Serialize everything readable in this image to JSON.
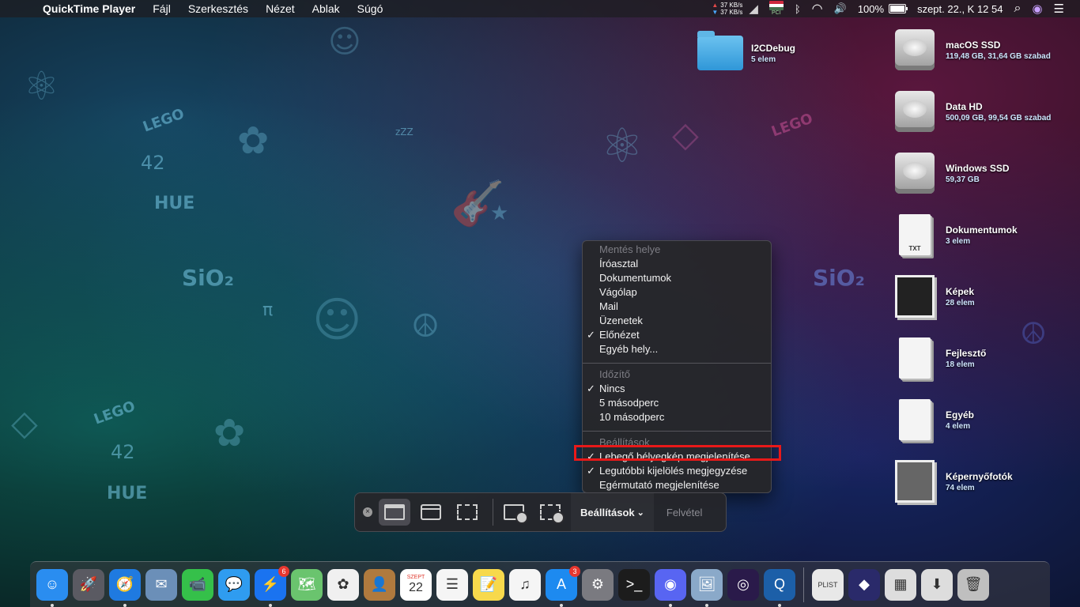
{
  "menubar": {
    "apple": "",
    "app_name": "QuickTime Player",
    "items": [
      "Fájl",
      "Szerkesztés",
      "Nézet",
      "Ablak",
      "Súgó"
    ],
    "net_up": "37 KB/s",
    "net_down": "37 KB/s",
    "pci_label": "PCI",
    "bluetooth": "ᛒ",
    "volume": "🔊",
    "wifi": "◠",
    "battery_percent": "100%",
    "battery_level": 1.0,
    "datetime": "szept. 22., K  12 54",
    "search": "⌕",
    "siri": "◉",
    "menu_list": "☰"
  },
  "desktop": [
    {
      "name": "I2CDebug",
      "sub": "5 elem",
      "kind": "folder"
    },
    {
      "name": "macOS SSD",
      "sub": "119,48 GB, 31,64 GB szabad",
      "kind": "hdd"
    },
    {
      "name": "Data HD",
      "sub": "500,09 GB, 99,54 GB szabad",
      "kind": "hdd"
    },
    {
      "name": "Windows SSD",
      "sub": "59,37 GB",
      "kind": "hdd"
    },
    {
      "name": "Dokumentumok",
      "sub": "3 elem",
      "kind": "doc",
      "icon_label": "TXT"
    },
    {
      "name": "Képek",
      "sub": "28 elem",
      "kind": "stack"
    },
    {
      "name": "Fejlesztő",
      "sub": "18 elem",
      "kind": "doc",
      "icon_label": ""
    },
    {
      "name": "Egyéb",
      "sub": "4 elem",
      "kind": "doc",
      "icon_label": ""
    },
    {
      "name": "Képernyőfotók",
      "sub": "74 elem",
      "kind": "stack"
    }
  ],
  "wallpaper_text": {
    "hue": "HUE",
    "sio2": "SiO₂",
    "lego": "LEGO",
    "n42": "42",
    "zzz": "zZZ",
    "pi": "π"
  },
  "popup": {
    "sections": [
      {
        "header": "Mentés helye",
        "items": [
          {
            "label": "Íróasztal",
            "checked": false
          },
          {
            "label": "Dokumentumok",
            "checked": false
          },
          {
            "label": "Vágólap",
            "checked": false
          },
          {
            "label": "Mail",
            "checked": false
          },
          {
            "label": "Üzenetek",
            "checked": false
          },
          {
            "label": "Előnézet",
            "checked": true
          },
          {
            "label": "Egyéb hely...",
            "checked": false
          }
        ]
      },
      {
        "header": "Időzítő",
        "items": [
          {
            "label": "Nincs",
            "checked": true
          },
          {
            "label": "5 másodperc",
            "checked": false
          },
          {
            "label": "10 másodperc",
            "checked": false
          }
        ]
      },
      {
        "header": "Beállítások",
        "items": [
          {
            "label": "Lebegő bélyegkép megjelenítése",
            "checked": true
          },
          {
            "label": "Legutóbbi kijelölés megjegyzése",
            "checked": true
          },
          {
            "label": "Egérmutató megjelenítése",
            "checked": false
          }
        ]
      }
    ],
    "check_glyph": "✓"
  },
  "toolbar": {
    "close": "×",
    "options_label": "Beállítások",
    "options_chevron": "⌄",
    "capture_label": "Felvétel"
  },
  "dock": {
    "apps": [
      {
        "name": "finder",
        "glyph": "☺",
        "color": "#2a8df0",
        "running": true,
        "badge": ""
      },
      {
        "name": "launchpad",
        "glyph": "🚀",
        "color": "#5a5a62",
        "running": false,
        "badge": ""
      },
      {
        "name": "safari",
        "glyph": "🧭",
        "color": "#1f7ae0",
        "running": true,
        "badge": ""
      },
      {
        "name": "mail-stamp",
        "glyph": "✉",
        "color": "#6b8fb8",
        "running": false,
        "badge": ""
      },
      {
        "name": "facetime",
        "glyph": "📹",
        "color": "#35c04a",
        "running": false,
        "badge": ""
      },
      {
        "name": "messages",
        "glyph": "💬",
        "color": "#2f9cf0",
        "running": false,
        "badge": ""
      },
      {
        "name": "messenger",
        "glyph": "⚡",
        "color": "#1a73f0",
        "running": true,
        "badge": "6"
      },
      {
        "name": "maps",
        "glyph": "🗺",
        "color": "#6ac46e",
        "running": false,
        "badge": ""
      },
      {
        "name": "photos",
        "glyph": "✿",
        "color": "#f0f0f0",
        "running": false,
        "badge": ""
      },
      {
        "name": "contacts",
        "glyph": "👤",
        "color": "#b07a3e",
        "running": false,
        "badge": ""
      },
      {
        "name": "calendar",
        "glyph": "22",
        "color": "#ffffff",
        "running": false,
        "badge": "",
        "sub": "SZEPT"
      },
      {
        "name": "reminders",
        "glyph": "☰",
        "color": "#f5f5f5",
        "running": false,
        "badge": ""
      },
      {
        "name": "notes",
        "glyph": "📝",
        "color": "#f7d94c",
        "running": false,
        "badge": ""
      },
      {
        "name": "music",
        "glyph": "♫",
        "color": "#f5f5f5",
        "running": false,
        "badge": ""
      },
      {
        "name": "app-store",
        "glyph": "A",
        "color": "#1d8af0",
        "running": true,
        "badge": "3"
      },
      {
        "name": "system-preferences",
        "glyph": "⚙",
        "color": "#7a7a80",
        "running": false,
        "badge": ""
      },
      {
        "name": "terminal",
        "glyph": ">_",
        "color": "#1c1c1c",
        "running": false,
        "badge": ""
      },
      {
        "name": "discord",
        "glyph": "◉",
        "color": "#5865f2",
        "running": true,
        "badge": ""
      },
      {
        "name": "preview",
        "glyph": "🖼",
        "color": "#8aa9c9",
        "running": true,
        "badge": ""
      },
      {
        "name": "creative-app",
        "glyph": "◎",
        "color": "#2a1a4a",
        "running": false,
        "badge": ""
      },
      {
        "name": "quicktime",
        "glyph": "Q",
        "color": "#1c5fa8",
        "running": true,
        "badge": ""
      }
    ],
    "right": [
      {
        "name": "plist-file",
        "glyph": "PLIST",
        "color": "#e8e8e8"
      },
      {
        "name": "cube-app",
        "glyph": "◆",
        "color": "#2a2a6a"
      },
      {
        "name": "screenshots-stack",
        "glyph": "▦",
        "color": "#dddddd"
      },
      {
        "name": "downloads-stack",
        "glyph": "⬇",
        "color": "#dddddd"
      },
      {
        "name": "trash",
        "glyph": "🗑",
        "color": "#bfbfbf"
      }
    ]
  }
}
